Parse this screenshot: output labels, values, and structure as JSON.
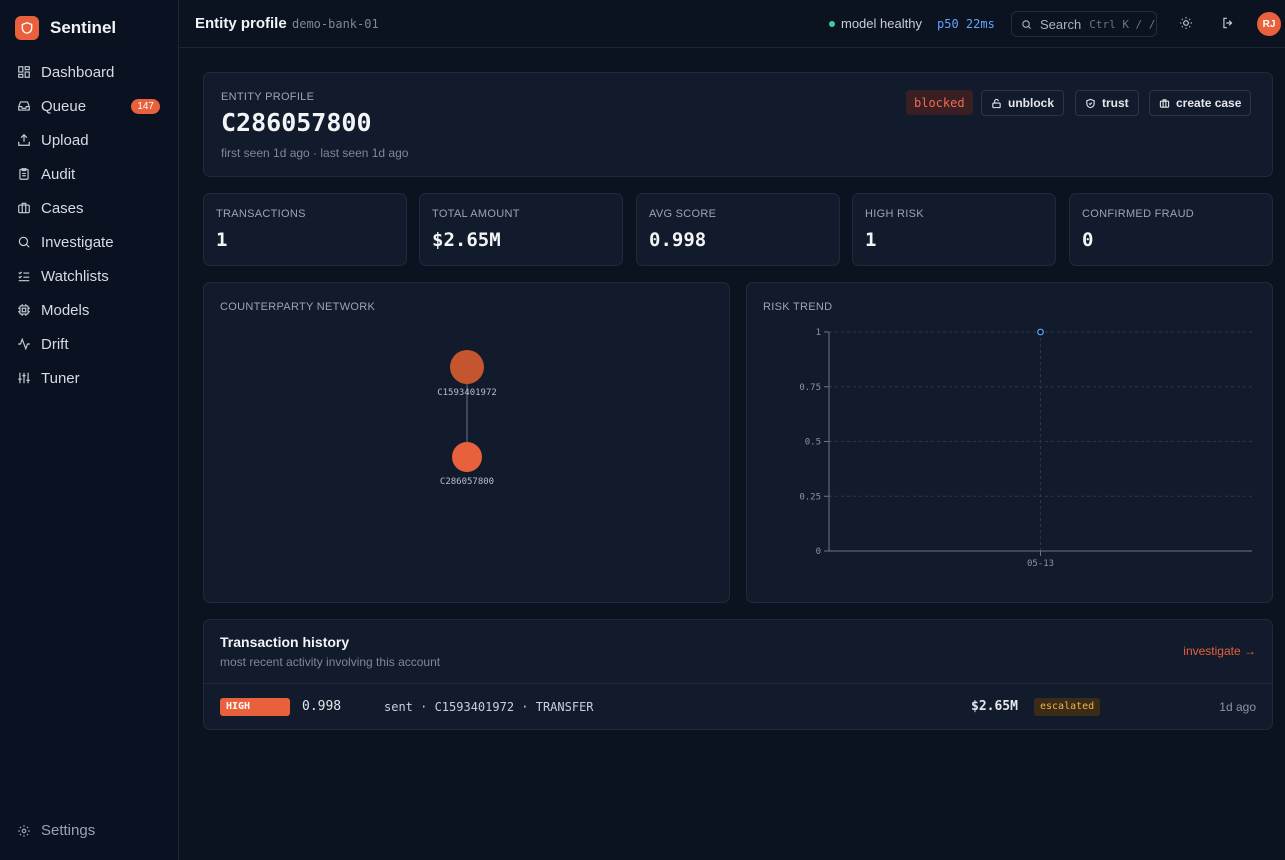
{
  "app": {
    "name": "Sentinel"
  },
  "sidebar": {
    "items": [
      {
        "label": "Dashboard",
        "icon": "dashboard-icon"
      },
      {
        "label": "Queue",
        "icon": "inbox-icon",
        "badge": "147"
      },
      {
        "label": "Upload",
        "icon": "upload-icon"
      },
      {
        "label": "Audit",
        "icon": "clipboard-icon"
      },
      {
        "label": "Cases",
        "icon": "briefcase-icon"
      },
      {
        "label": "Investigate",
        "icon": "search-icon"
      },
      {
        "label": "Watchlists",
        "icon": "list-check-icon"
      },
      {
        "label": "Models",
        "icon": "cpu-icon"
      },
      {
        "label": "Drift",
        "icon": "activity-icon"
      },
      {
        "label": "Tuner",
        "icon": "sliders-icon"
      }
    ],
    "settings_label": "Settings"
  },
  "topbar": {
    "title": "Entity profile",
    "workspace": "demo-bank-01",
    "health": "model healthy",
    "latency": "p50 22ms",
    "search_label": "Search",
    "search_shortcut": "Ctrl K / /",
    "avatar_initials": "RJ"
  },
  "profile": {
    "label": "ENTITY PROFILE",
    "entity_id": "C286057800",
    "seen": "first seen 1d ago · last seen 1d ago",
    "status": "blocked",
    "actions": {
      "unblock": "unblock",
      "trust": "trust",
      "create_case": "create case"
    }
  },
  "stats": [
    {
      "label": "TRANSACTIONS",
      "value": "1"
    },
    {
      "label": "TOTAL AMOUNT",
      "value": "$2.65M"
    },
    {
      "label": "AVG SCORE",
      "value": "0.998"
    },
    {
      "label": "HIGH RISK",
      "value": "1"
    },
    {
      "label": "CONFIRMED FRAUD",
      "value": "0"
    }
  ],
  "network": {
    "label": "COUNTERPARTY NETWORK",
    "nodes": [
      {
        "id": "C1593401972",
        "role": "counterparty"
      },
      {
        "id": "C286057800",
        "role": "self"
      }
    ]
  },
  "risk_trend": {
    "label": "RISK TREND"
  },
  "chart_data": {
    "type": "line",
    "title": "RISK TREND",
    "xlabel": "",
    "ylabel": "",
    "x": [
      "05-13"
    ],
    "ylim": [
      0,
      1
    ],
    "yticks": [
      "0",
      "0.25",
      "0.5",
      "0.75",
      "1"
    ],
    "series": [
      {
        "values": [
          1
        ]
      }
    ],
    "grid": true
  },
  "history": {
    "title": "Transaction history",
    "subtitle": "most recent activity involving this account",
    "link": "investigate →",
    "rows": [
      {
        "risk": "HIGH",
        "score": "0.998",
        "description": "sent · C1593401972 · TRANSFER",
        "amount": "$2.65M",
        "status": "escalated",
        "time": "1d ago"
      }
    ]
  },
  "colors": {
    "accent": "#e8603c",
    "background": "#0b1220",
    "card": "#111b2c",
    "health": "#34d399",
    "latency": "#60a5fa",
    "escalated": "#f0b44c"
  }
}
